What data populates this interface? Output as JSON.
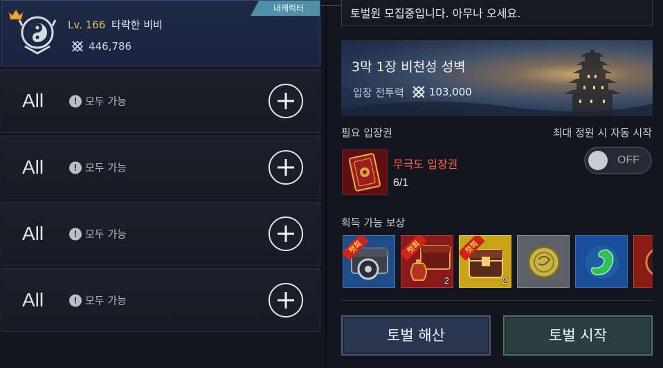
{
  "my_character": {
    "tag": "내캐릭터",
    "level": "Lv. 166",
    "name": "타락한 비비",
    "combat_power": "446,786",
    "icons": {
      "leader": "crown-icon",
      "emblem": "guild-emblem-icon",
      "power": "combat-power-icon"
    }
  },
  "slots": [
    {
      "class_label": "All",
      "status": "모두 가능"
    },
    {
      "class_label": "All",
      "status": "모두 가능"
    },
    {
      "class_label": "All",
      "status": "모두 가능"
    },
    {
      "class_label": "All",
      "status": "모두 가능"
    }
  ],
  "chat": {
    "message": "토벌원 모집중입니다. 아무나 오세요."
  },
  "stage": {
    "title": "3막 1장 비천성 성벽",
    "entry_power_label": "입장 전투력",
    "entry_power": "103,000"
  },
  "ticket": {
    "section_label": "필요 입장권",
    "name": "무극도 입장권",
    "count": "6/1"
  },
  "auto_start": {
    "label": "최대 정원 시 자동 시작",
    "state": "OFF"
  },
  "rewards": {
    "section_label": "획득 가능 보상",
    "items": [
      {
        "icon": "steel-chest-icon",
        "first_clear": "첫회",
        "qty": ""
      },
      {
        "icon": "red-chest-potion-icon",
        "first_clear": "첫회",
        "qty": "2"
      },
      {
        "icon": "gold-chest-icon",
        "first_clear": "첫회",
        "qty": "2"
      },
      {
        "icon": "gold-coin-icon",
        "first_clear": "",
        "qty": ""
      },
      {
        "icon": "jade-icon",
        "first_clear": "",
        "qty": ""
      },
      {
        "icon": "red-ornament-icon",
        "first_clear": "",
        "qty": ""
      }
    ]
  },
  "buttons": {
    "disband": "토벌 해산",
    "start": "토벌 시작"
  },
  "colors": {
    "my_slot_bg": "#1e2a45",
    "tag_bg": "#4f8fa8",
    "level_text": "#e9c46a",
    "ticket_name": "#ff5a4a",
    "disband_bg": "#2a3550",
    "start_bg": "#29403f"
  }
}
